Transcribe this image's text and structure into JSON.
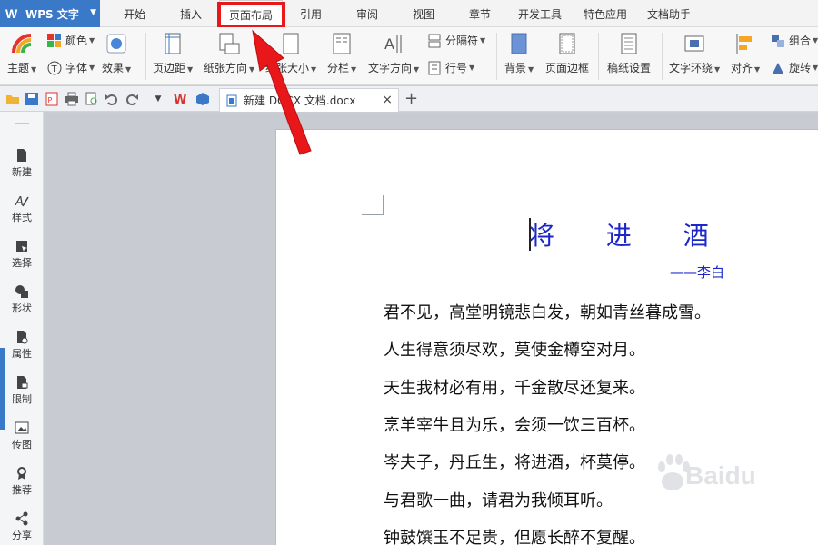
{
  "app": {
    "title": "WPS 文字"
  },
  "menu": {
    "tabs": [
      "开始",
      "插入",
      "页面布局",
      "引用",
      "审阅",
      "视图",
      "章节",
      "开发工具",
      "特色应用",
      "文档助手"
    ],
    "active_tab": "页面布局"
  },
  "ribbon": {
    "theme": "主题",
    "color": "颜色",
    "font": "字体",
    "effect": "效果",
    "margins": "页边距",
    "orientation": "纸张方向",
    "paper_size": "纸张大小",
    "columns": "分栏",
    "text_direction": "文字方向",
    "separator": "分隔符",
    "line_number": "行号",
    "background": "背景",
    "page_border": "页面边框",
    "manuscript": "稿纸设置",
    "text_wrap": "文字环绕",
    "align": "对齐",
    "group": "组合",
    "rotate": "旋转"
  },
  "tabbar": {
    "doc_name": "新建 DOCX 文档.docx"
  },
  "sidebar": {
    "items": [
      "新建",
      "样式",
      "选择",
      "形状",
      "属性",
      "限制",
      "传图",
      "推荐",
      "分享"
    ]
  },
  "document": {
    "title": "将 进 酒",
    "author": "——李白",
    "lines": [
      "君不见，高堂明镜悲白发，朝如青丝暮成雪。",
      "人生得意须尽欢，莫使金樽空对月。",
      "天生我材必有用，千金散尽还复来。",
      "烹羊宰牛且为乐，会须一饮三百杯。",
      "岑夫子，丹丘生，将进酒，杯莫停。",
      "与君歌一曲，请君为我倾耳听。",
      "钟鼓馔玉不足贵，但愿长醉不复醒。"
    ]
  },
  "watermark": {
    "text": "Baidu"
  },
  "colors": {
    "accent": "#3a78c8",
    "highlight": "#e8181a",
    "poem_title": "#1b27c8"
  }
}
